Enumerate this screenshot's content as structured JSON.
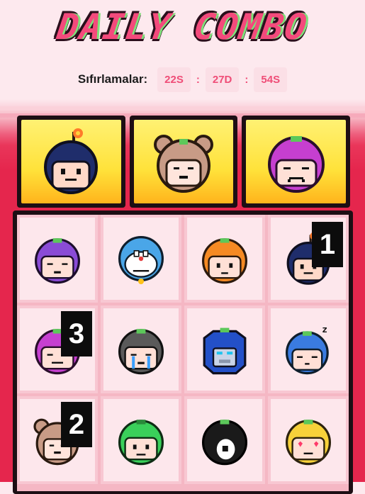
{
  "title": "DAILY COMBO",
  "timer": {
    "label": "Sıfırlamalar:",
    "hours": "22S",
    "minutes": "27D",
    "seconds": "54S",
    "separator": ":"
  },
  "slots": [
    {
      "character": "navy-bomb-head"
    },
    {
      "character": "bear-hood-head"
    },
    {
      "character": "magenta-sad-head"
    }
  ],
  "grid": [
    {
      "character": "purple-angry-head",
      "badge": null
    },
    {
      "character": "blue-cat-robot-head",
      "badge": null
    },
    {
      "character": "orange-head",
      "badge": null
    },
    {
      "character": "navy-bomb-head",
      "badge": "1"
    },
    {
      "character": "magenta-sad-head",
      "badge": "3"
    },
    {
      "character": "gray-crying-head",
      "badge": null
    },
    {
      "character": "blue-robot-helmet-head",
      "badge": null
    },
    {
      "character": "blue-sleeping-head",
      "badge": null
    },
    {
      "character": "bear-hood-head",
      "badge": "2"
    },
    {
      "character": "green-head",
      "badge": null
    },
    {
      "character": "panda-head",
      "badge": null
    },
    {
      "character": "yellow-heart-eyes-head",
      "badge": null
    }
  ],
  "colors": {
    "accent": "#ef4d77",
    "background_pink": "#e5264d",
    "slot_yellow": "#ffe23a"
  }
}
